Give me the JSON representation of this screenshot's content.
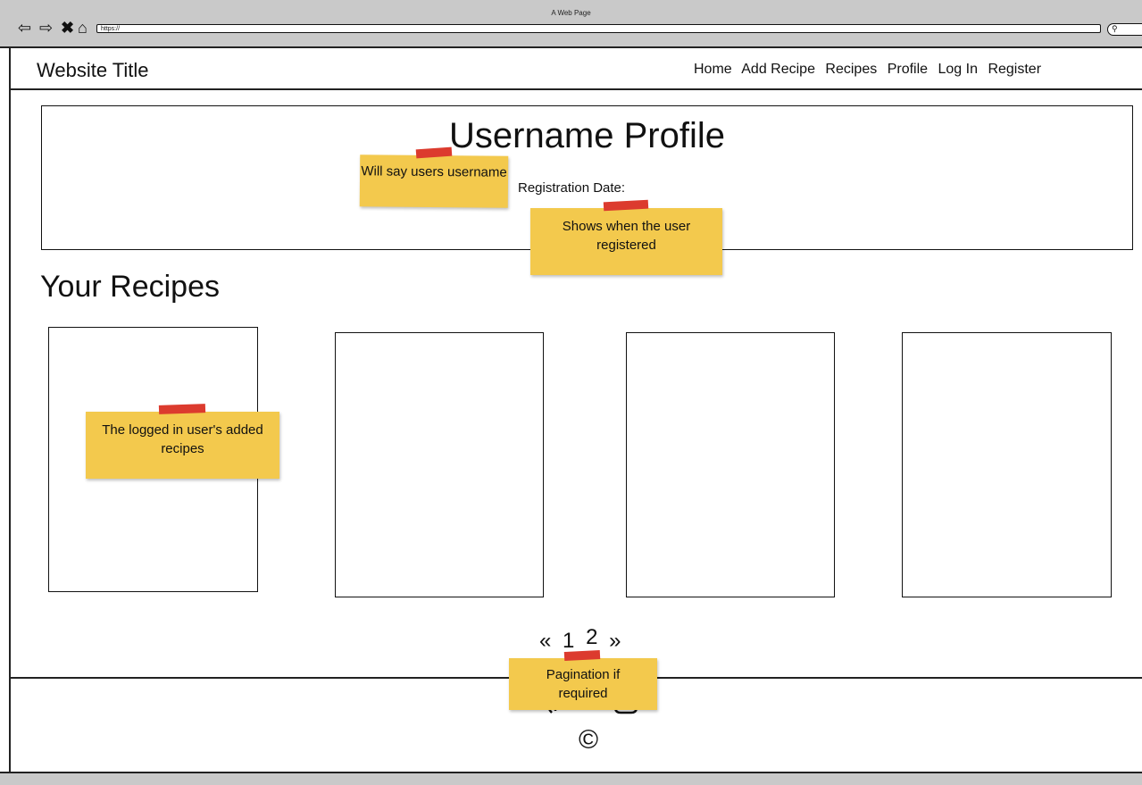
{
  "browser": {
    "window_title": "A Web Page",
    "url": "https://",
    "icons": [
      "back-arrow-icon",
      "forward-arrow-icon",
      "close-icon",
      "home-icon",
      "search-icon"
    ]
  },
  "header": {
    "site_title": "Website Title",
    "nav": [
      "Home",
      "Add Recipe",
      "Recipes",
      "Profile",
      "Log In",
      "Register"
    ]
  },
  "profile": {
    "title": "Username Profile",
    "registration_label": "Registration Date:"
  },
  "recipes": {
    "heading": "Your Recipes",
    "card_count": 4
  },
  "pagination": {
    "prev": "«",
    "pages": [
      "1",
      "2"
    ],
    "next": "»"
  },
  "footer": {
    "icons": [
      "facebook-icon",
      "instagram-icon"
    ],
    "copyright": "©"
  },
  "notes": {
    "username_note": "Will say users username",
    "registration_note": "Shows when the user registered",
    "recipes_note": "The logged in user's added recipes",
    "pagination_note": "Pagination if required"
  },
  "colors": {
    "sticky_note": "#f3c94d",
    "tape": "#dc3b2e",
    "chrome": "#c9c9c9"
  }
}
